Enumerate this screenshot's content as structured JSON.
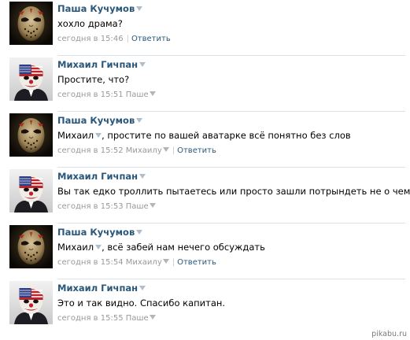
{
  "comments": [
    {
      "author": "Паша Кучумов",
      "avatar": "jason-hockey-mask",
      "mention": "",
      "text": "хохло драма?",
      "time": "сегодня в 15:46",
      "reply_to": "",
      "reply_label": "Ответить"
    },
    {
      "author": "Михаил Гичпан",
      "avatar": "dallas-clown-mask",
      "mention": "",
      "text": "Простите, что?",
      "time": "сегодня в 15:51",
      "reply_to": "Паше",
      "reply_label": ""
    },
    {
      "author": "Паша Кучумов",
      "avatar": "jason-hockey-mask",
      "mention": "Михаил",
      "text": ", простите по вашей аватарке всё понятно без слов",
      "time": "сегодня в 15:52",
      "reply_to": "Михаилу",
      "reply_label": "Ответить"
    },
    {
      "author": "Михаил Гичпан",
      "avatar": "dallas-clown-mask",
      "mention": "",
      "text": "Вы так едко троллить пытаетесь или просто зашли потрындеть не о чем?",
      "time": "сегодня в 15:53",
      "reply_to": "Паше",
      "reply_label": ""
    },
    {
      "author": "Паша Кучумов",
      "avatar": "jason-hockey-mask",
      "mention": "Михаил",
      "text": ", всё забей нам нечего обсуждать",
      "time": "сегодня в 15:54",
      "reply_to": "Михаилу",
      "reply_label": "Ответить"
    },
    {
      "author": "Михаил Гичпан",
      "avatar": "dallas-clown-mask",
      "mention": "",
      "text": "Это и так видно. Спасибо капитан.",
      "time": "сегодня в 15:55",
      "reply_to": "Паше",
      "reply_label": ""
    }
  ],
  "watermark": "pikabu.ru",
  "colors": {
    "author_link": "#2b587a",
    "meta_text": "#999999",
    "separator": "#dae1e8"
  }
}
